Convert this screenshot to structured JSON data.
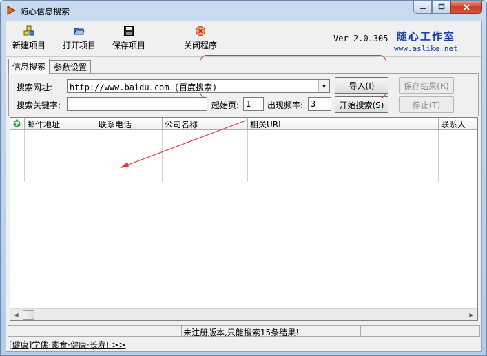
{
  "window": {
    "title": "随心信息搜索"
  },
  "toolbar": {
    "new_project": "新建项目",
    "open_project": "打开项目",
    "save_project": "保存项目",
    "close_program": "关闭程序",
    "version": "Ver 2.0.305",
    "logo_text": "随心工作室",
    "logo_url": "www.aslike.net"
  },
  "tabs": [
    {
      "label": "信息搜索",
      "active": true
    },
    {
      "label": "参数设置",
      "active": false
    }
  ],
  "search": {
    "url_label": "搜索网址:",
    "url_value": "http://www.baidu.com (百度搜索)",
    "keyword_label": "搜索关键字:",
    "keyword_value": "",
    "start_page_label": "起始页:",
    "start_page_value": "1",
    "frequency_label": "出现频率:",
    "frequency_value": "3",
    "import_button": "导入(I)",
    "start_button": "开始搜索(S)",
    "save_results_button": "保存结果(R)",
    "stop_button": "停止(T)"
  },
  "grid": {
    "columns": [
      "邮件地址",
      "联系电话",
      "公司名称",
      "相关URL",
      "联系人"
    ],
    "rows": [
      [
        "",
        "",
        "",
        "",
        ""
      ],
      [
        "",
        "",
        "",
        "",
        ""
      ],
      [
        "",
        "",
        "",
        "",
        ""
      ],
      [
        "",
        "",
        "",
        "",
        ""
      ]
    ]
  },
  "status": {
    "message": "未注册版本,只能搜索15条结果!",
    "link": "[健康]学佛·素食·健康·长寿! >>"
  },
  "colors": {
    "highlight": "#e0343a",
    "logo": "#1a3fa8"
  }
}
